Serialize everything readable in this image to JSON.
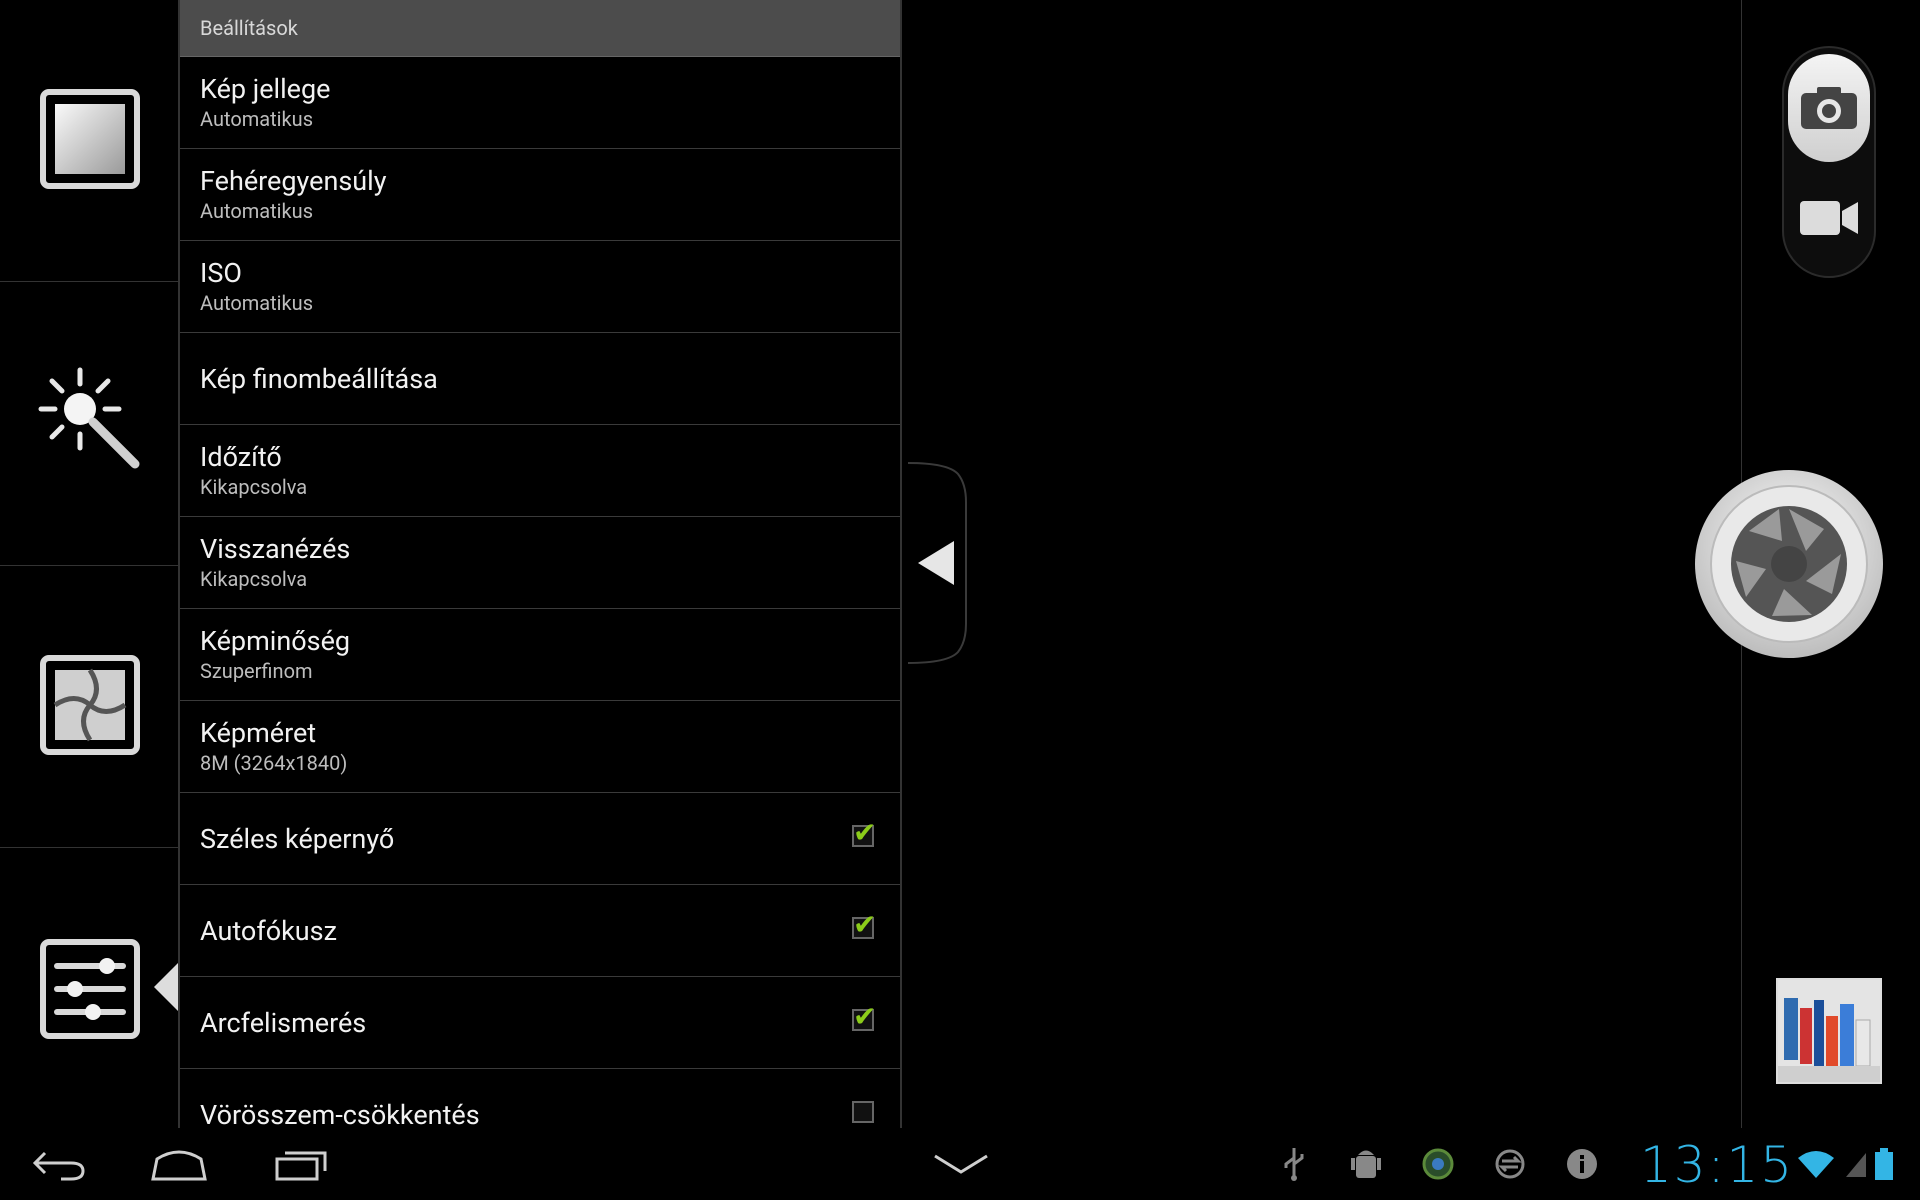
{
  "settings": {
    "header": "Beállítások",
    "items": [
      {
        "title": "Kép jellege",
        "sub": "Automatikus"
      },
      {
        "title": "Fehéregyensúly",
        "sub": "Automatikus"
      },
      {
        "title": "ISO",
        "sub": "Automatikus"
      },
      {
        "title": "Kép finombeállítása"
      },
      {
        "title": "Időzítő",
        "sub": "Kikapcsolva"
      },
      {
        "title": "Visszanézés",
        "sub": "Kikapcsolva"
      },
      {
        "title": "Képminőség",
        "sub": "Szuperfinom"
      },
      {
        "title": "Képméret",
        "sub": "8M (3264x1840)"
      },
      {
        "title": "Széles képernyő",
        "checked": true
      },
      {
        "title": "Autofókusz",
        "checked": true
      },
      {
        "title": "Arcfelismerés",
        "checked": true
      },
      {
        "title": "Vörösszem-csökkentés",
        "checked": false
      }
    ]
  },
  "status": {
    "clock": "13:15"
  },
  "colors": {
    "accent": "#33b5e5",
    "checkmark": "#8ccc1a",
    "header_bg": "#4c4c4c"
  }
}
